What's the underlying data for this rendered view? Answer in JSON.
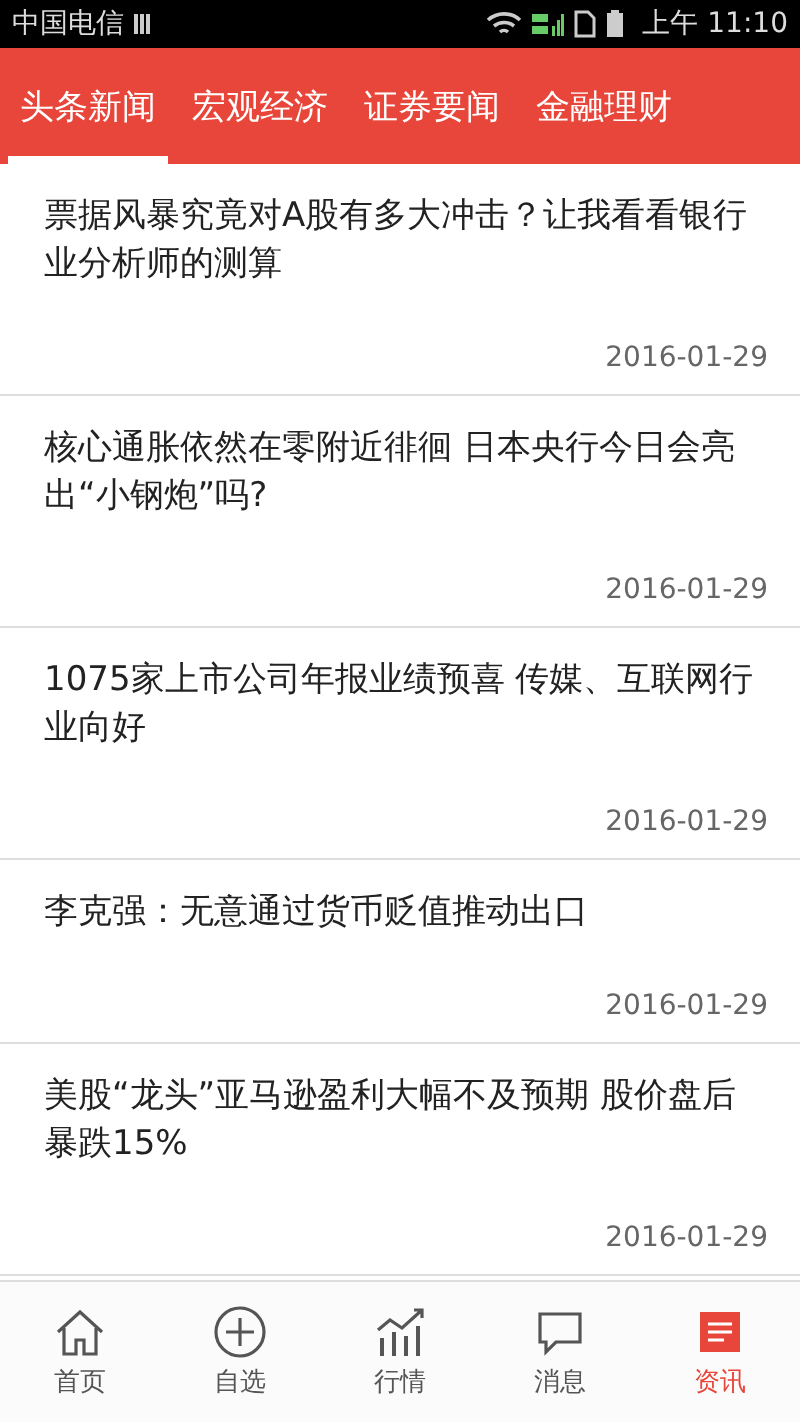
{
  "status_bar": {
    "carrier": "中国电信",
    "time": "上午 11:10"
  },
  "tabs": [
    {
      "label": "头条新闻",
      "selected": true
    },
    {
      "label": "宏观经济",
      "selected": false
    },
    {
      "label": "证券要闻",
      "selected": false
    },
    {
      "label": "金融理财",
      "selected": false
    }
  ],
  "articles": [
    {
      "title": "票据风暴究竟对A股有多大冲击？让我看看银行业分析师的测算",
      "date": "2016-01-29"
    },
    {
      "title": "核心通胀依然在零附近徘徊 日本央行今日会亮出“小钢炮”吗?",
      "date": "2016-01-29"
    },
    {
      "title": "1075家上市公司年报业绩预喜 传媒、互联网行业向好",
      "date": "2016-01-29"
    },
    {
      "title": "李克强：无意通过货币贬值推动出口",
      "date": "2016-01-29"
    },
    {
      "title": "美股“龙头”亚马逊盈利大幅不及预期 股价盘后暴跌15%",
      "date": "2016-01-29"
    }
  ],
  "bottom_nav": [
    {
      "label": "首页",
      "kind": "home",
      "selected": false
    },
    {
      "label": "自选",
      "kind": "add",
      "selected": false
    },
    {
      "label": "行情",
      "kind": "chart",
      "selected": false
    },
    {
      "label": "消息",
      "kind": "message",
      "selected": false
    },
    {
      "label": "资讯",
      "kind": "news",
      "selected": true
    }
  ]
}
